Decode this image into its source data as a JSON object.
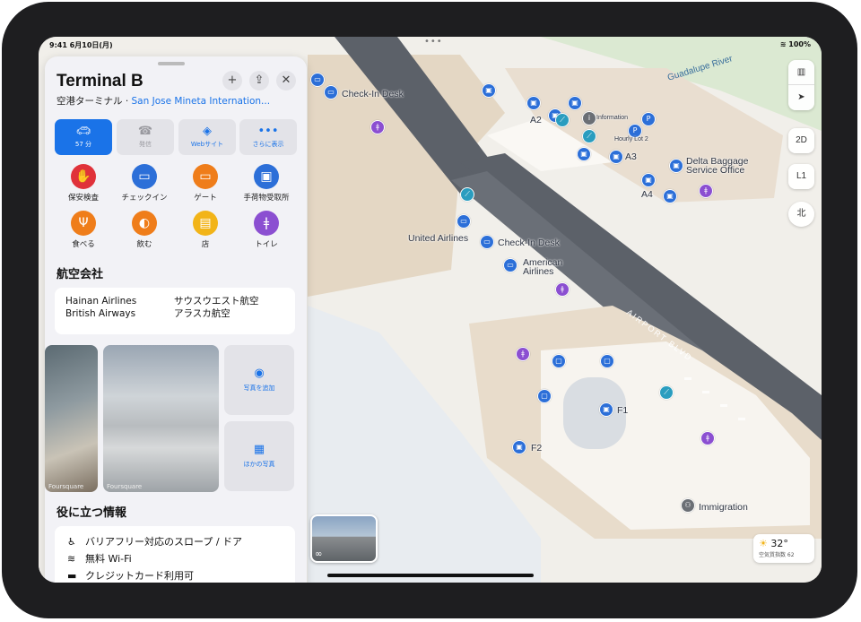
{
  "status": {
    "time": "9:41 6月10日(月)",
    "right": "100%"
  },
  "sheet": {
    "title": "Terminal B",
    "subtitle_prefix": "空港ターミナル · ",
    "subtitle_link": "San Jose Mineta Internation...",
    "actions": [
      {
        "label": "57 分",
        "icon": "car-icon"
      },
      {
        "label": "発信",
        "icon": "phone-icon"
      },
      {
        "label": "Webサイト",
        "icon": "compass-icon"
      },
      {
        "label": "さらに表示",
        "icon": "more-icon"
      }
    ],
    "categories": [
      {
        "label": "保安検査",
        "color": "#e0323a",
        "glyph": "✋"
      },
      {
        "label": "チェックイン",
        "color": "#2c6fd8",
        "glyph": "▭"
      },
      {
        "label": "ゲート",
        "color": "#ef7d1a",
        "glyph": "▭"
      },
      {
        "label": "手荷物受取所",
        "color": "#2c6fd8",
        "glyph": "▣"
      },
      {
        "label": "食べる",
        "color": "#ef7d1a",
        "glyph": "Ψ"
      },
      {
        "label": "飲む",
        "color": "#ef7d1a",
        "glyph": "◐"
      },
      {
        "label": "店",
        "color": "#f2b418",
        "glyph": "▤"
      },
      {
        "label": "トイレ",
        "color": "#8b4fd1",
        "glyph": "ǂ"
      }
    ],
    "airlines_heading": "航空会社",
    "airlines": [
      "Hainan Airlines",
      "British Airways",
      "サウスウエスト航空",
      "アラスカ航空"
    ],
    "photo_source": "Foursquare",
    "add_photo": "写真を追加",
    "more_photos": "ほかの写真",
    "info_heading": "役に立つ情報",
    "info": [
      {
        "icon": "accessibility-icon",
        "glyph": "♿",
        "label": "バリアフリー対応のスロープ / ドア"
      },
      {
        "icon": "wifi-icon",
        "glyph": "≋",
        "label": "無料 Wi-Fi"
      },
      {
        "icon": "credit-card-icon",
        "glyph": "▬",
        "label": "クレジットカード利用可"
      }
    ]
  },
  "map": {
    "labels": {
      "checkin1": "Check-In Desk",
      "checkin2": "Check-In Desk",
      "united": "United Airlines",
      "american": "American\nAirlines",
      "a2": "A2",
      "a3": "A3",
      "a4": "A4",
      "f1": "F1",
      "f2": "F2",
      "information": "Information",
      "hourly": "Hourly Lot 2",
      "delta": "Delta Baggage\nService Office",
      "immigration": "Immigration",
      "road": "AIRPORT BLVD",
      "river": "Guadalupe River"
    },
    "controls": {
      "view2d": "2D",
      "level": "L1",
      "compass": "北"
    },
    "weather": {
      "temp": "32°",
      "aqi": "空気質指数 62"
    }
  },
  "colors": {
    "accent": "#1a73e8",
    "checkin": "#2c6fd8"
  }
}
